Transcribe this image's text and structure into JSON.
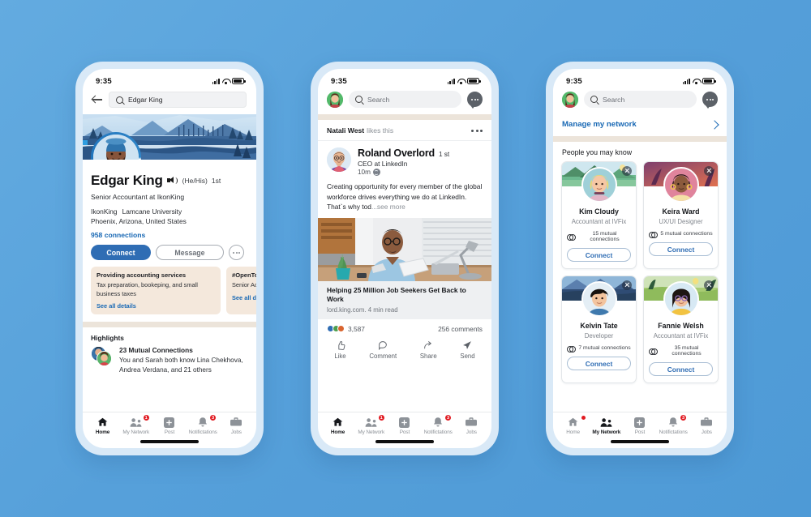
{
  "statusbar": {
    "time": "9:35"
  },
  "phone1": {
    "search": {
      "value": "Edgar King",
      "placeholder": "Search"
    },
    "profile": {
      "name": "Edgar King",
      "pronouns": "(He/His)",
      "degree": "1st",
      "headline": "Senior Accountant at IkonKing",
      "company": "IkonKing",
      "school": "Lamcane University",
      "location": "Phoenix, Arizona, United States",
      "connections": "958 connections",
      "company_badge": "ni"
    },
    "actions": {
      "connect": "Connect",
      "message": "Message",
      "more": "more-options"
    },
    "cards": [
      {
        "title": "Providing accounting services",
        "body": "Tax preparation, bookeping, and small business taxes",
        "link": "See all details"
      },
      {
        "title": "#OpenToW",
        "body": "Senior Ac\nManager",
        "link": "See all de"
      }
    ],
    "highlights": {
      "section_title": "Highlights",
      "title": "23 Mutual Connections",
      "body": "You and Sarah both know Lina Chekhova, Andrea Verdana, and 21 others"
    },
    "tabs": [
      {
        "label": "Home",
        "icon": "home-icon",
        "active": true,
        "badge": ""
      },
      {
        "label": "My Network",
        "icon": "network-icon",
        "active": false,
        "badge": "1"
      },
      {
        "label": "Post",
        "icon": "post-icon",
        "active": false,
        "badge": ""
      },
      {
        "label": "Notifictations",
        "icon": "bell-icon",
        "active": false,
        "badge": "3"
      },
      {
        "label": "Jobs",
        "icon": "jobs-icon",
        "active": false,
        "badge": ""
      }
    ]
  },
  "phone2": {
    "search": {
      "placeholder": "Search"
    },
    "social_proof": {
      "name": "Natali West",
      "action": "likes this"
    },
    "post": {
      "author": "Roland Overlord",
      "degree": "1 st",
      "subtitle": "CEO at LinkedIn",
      "time": "10m",
      "text": "Creating opportunity for every member of the global workforce drives everything we do at LinkedIn. That`s why tod",
      "see_more": "...see more",
      "link_title": "Helping 25 Million Job Seekers Get Back to Work",
      "link_meta": "lord.king.com. 4 min read",
      "reactions_count": "3,587",
      "comments": "256 comments",
      "actions": [
        {
          "label": "Like",
          "icon": "thumbs-up-icon"
        },
        {
          "label": "Comment",
          "icon": "comment-icon"
        },
        {
          "label": "Share",
          "icon": "share-icon"
        },
        {
          "label": "Send",
          "icon": "send-icon"
        }
      ]
    },
    "tabs": [
      {
        "label": "Home",
        "icon": "home-icon",
        "active": true,
        "badge": ""
      },
      {
        "label": "My Network",
        "icon": "network-icon",
        "active": false,
        "badge": "1"
      },
      {
        "label": "Post",
        "icon": "post-icon",
        "active": false,
        "badge": ""
      },
      {
        "label": "Notifictations",
        "icon": "bell-icon",
        "active": false,
        "badge": "3"
      },
      {
        "label": "Jobs",
        "icon": "jobs-icon",
        "active": false,
        "badge": ""
      }
    ]
  },
  "phone3": {
    "search": {
      "placeholder": "Search"
    },
    "manage_link": "Manage my network",
    "section_title": "People you may know",
    "people": [
      {
        "name": "Kim Cloudy",
        "role": "Accountant at IVFix",
        "mutual": "15 mutual connections",
        "button": "Connect"
      },
      {
        "name": "Keira Ward",
        "role": "UX/UI Designer",
        "mutual": "5 mutual connections",
        "button": "Connect"
      },
      {
        "name": "Kelvin Tate",
        "role": "Developer",
        "mutual": "7 mutual connections",
        "button": "Connect"
      },
      {
        "name": "Fannie Welsh",
        "role": "Accountant at IVFix",
        "mutual": "35 mutual connections",
        "button": "Connect"
      }
    ],
    "tabs": [
      {
        "label": "Home",
        "icon": "home-icon",
        "active": false,
        "badge": "•"
      },
      {
        "label": "My Network",
        "icon": "network-icon",
        "active": true,
        "badge": ""
      },
      {
        "label": "Post",
        "icon": "post-icon",
        "active": false,
        "badge": ""
      },
      {
        "label": "Notifictations",
        "icon": "bell-icon",
        "active": false,
        "badge": "3"
      },
      {
        "label": "Jobs",
        "icon": "jobs-icon",
        "active": false,
        "badge": ""
      }
    ]
  },
  "colors": {
    "background": "#56a0da",
    "phone_frame": "#d9e9f7",
    "brand_blue": "#2f6db4",
    "link_blue": "#1868b4",
    "badge_red": "#e11b22",
    "card_beige": "#f4e8dc",
    "band_beige": "#ece4da"
  }
}
